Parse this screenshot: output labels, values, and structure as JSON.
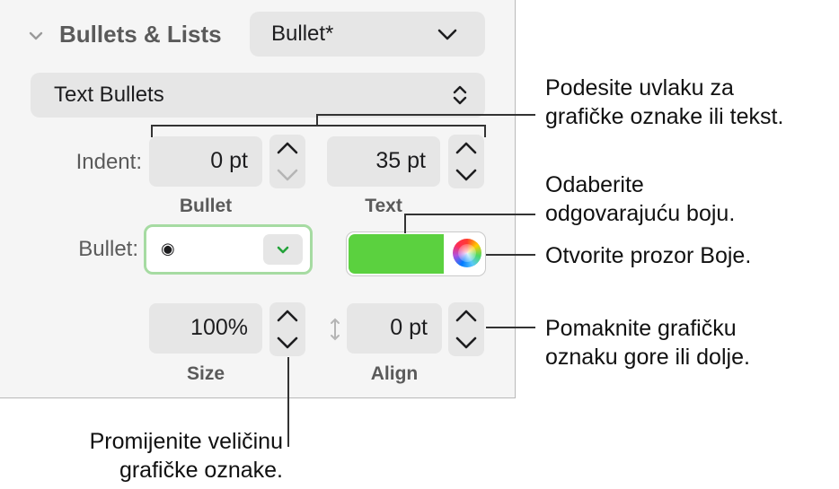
{
  "section": {
    "title": "Bullets & Lists",
    "style_popup_value": "Bullet*"
  },
  "bullet_type_popup": {
    "value": "Text Bullets"
  },
  "indent": {
    "label": "Indent:",
    "bullet_value": "0 pt",
    "bullet_sublabel": "Bullet",
    "text_value": "35 pt",
    "text_sublabel": "Text"
  },
  "bullet": {
    "label": "Bullet:",
    "symbol": "◉"
  },
  "color": {
    "swatch_color": "#5bd13f"
  },
  "size": {
    "value": "100%",
    "sublabel": "Size"
  },
  "align": {
    "value": "0 pt",
    "sublabel": "Align"
  },
  "callouts": {
    "indent_line1": "Podesite uvlaku za",
    "indent_line2": "grafičke oznake ili tekst.",
    "color_line1": "Odaberite",
    "color_line2": "odgovarajuću boju.",
    "colors_window": "Otvorite prozor Boje.",
    "align_line1": "Pomaknite grafičku",
    "align_line2": "oznaku gore ili dolje.",
    "size_line1": "Promijenite veličinu",
    "size_line2": "grafičke oznake."
  },
  "icons": {
    "section_toggle": "chevron-down-icon",
    "popup_arrow": "chevron-down-icon",
    "updown": "up-down-chevron-icon",
    "stepper": "stepper-icon",
    "align_arrow": "vertical-arrow-icon",
    "color_wheel": "color-wheel-icon"
  }
}
